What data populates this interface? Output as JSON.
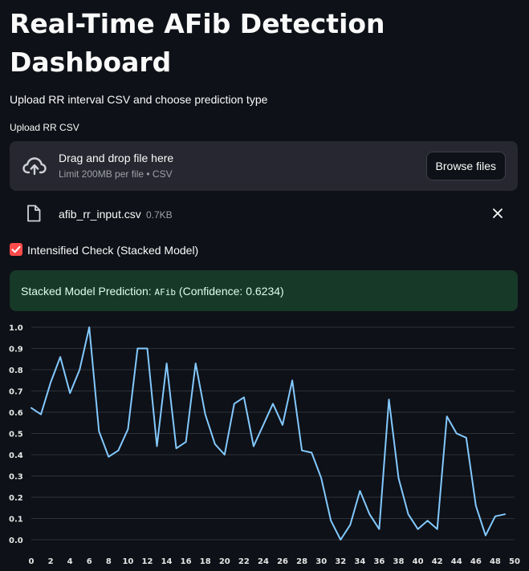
{
  "page": {
    "title": "Real-Time AFib Detection Dashboard",
    "subtitle": "Upload RR interval CSV and choose prediction type"
  },
  "uploader": {
    "label": "Upload RR CSV",
    "drop_text": "Drag and drop file here",
    "limit_text": "Limit 200MB per file • CSV",
    "browse_label": "Browse files",
    "upload_icon": "cloud-upload-icon"
  },
  "uploaded_file": {
    "name": "afib_rr_input.csv",
    "size": "0.7KB",
    "file_icon": "file-icon",
    "remove_icon": "close-icon"
  },
  "stacked_checkbox": {
    "label": "Intensified Check (Stacked Model)",
    "checked": true,
    "color": "#ff4b4b"
  },
  "result": {
    "prefix": "Stacked Model Prediction: ",
    "label": "AFib",
    "confidence_text": " (Confidence: 0.6234)",
    "bg_color": "#173928"
  },
  "chart_data": {
    "type": "line",
    "x": [
      0,
      1,
      2,
      3,
      4,
      5,
      6,
      7,
      8,
      9,
      10,
      11,
      12,
      13,
      14,
      15,
      16,
      17,
      18,
      19,
      20,
      21,
      22,
      23,
      24,
      25,
      26,
      27,
      28,
      29,
      30,
      31,
      32,
      33,
      34,
      35,
      36,
      37,
      38,
      39,
      40,
      41,
      42,
      43,
      44,
      45,
      46,
      47,
      48,
      49
    ],
    "values": [
      0.62,
      0.59,
      0.74,
      0.86,
      0.69,
      0.8,
      1.0,
      0.51,
      0.39,
      0.42,
      0.52,
      0.9,
      0.9,
      0.44,
      0.83,
      0.43,
      0.46,
      0.83,
      0.59,
      0.45,
      0.4,
      0.64,
      0.67,
      0.44,
      0.54,
      0.64,
      0.54,
      0.75,
      0.42,
      0.41,
      0.29,
      0.09,
      0.0,
      0.07,
      0.23,
      0.12,
      0.05,
      0.66,
      0.29,
      0.12,
      0.05,
      0.09,
      0.05,
      0.58,
      0.5,
      0.48,
      0.16,
      0.02,
      0.11,
      0.12
    ],
    "x_ticks": [
      0,
      2,
      4,
      6,
      8,
      10,
      12,
      14,
      16,
      18,
      20,
      22,
      24,
      26,
      28,
      30,
      32,
      34,
      36,
      38,
      40,
      42,
      44,
      46,
      48,
      50
    ],
    "y_ticks": [
      0.0,
      0.1,
      0.2,
      0.3,
      0.4,
      0.5,
      0.6,
      0.7,
      0.8,
      0.9,
      1.0
    ],
    "xlim": [
      0,
      50
    ],
    "ylim": [
      0,
      1.0
    ],
    "grid": "horizontal",
    "line_color": "#83c9ff",
    "title": "",
    "xlabel": "",
    "ylabel": ""
  }
}
